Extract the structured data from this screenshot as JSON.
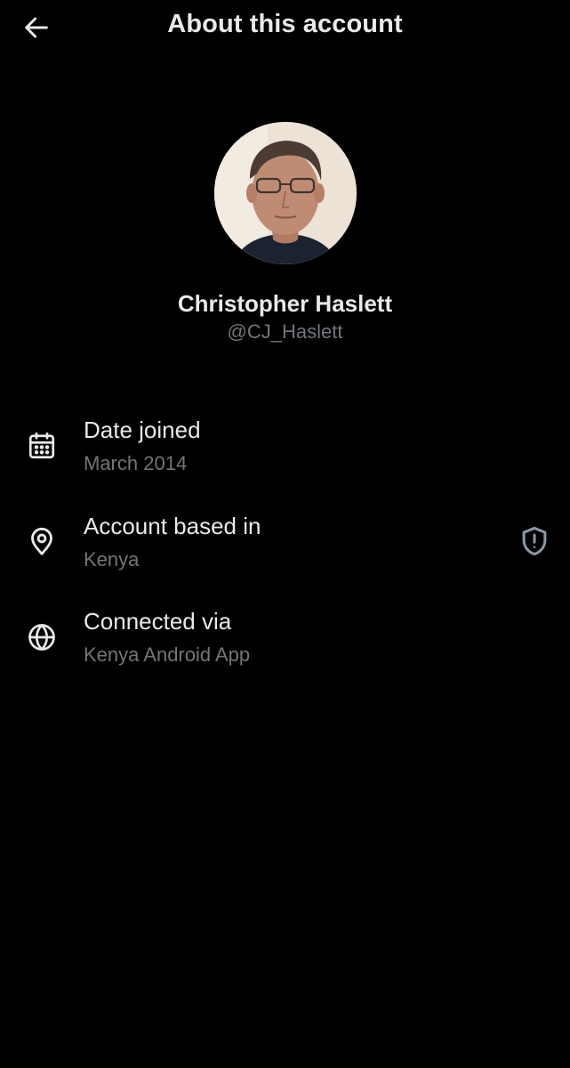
{
  "header": {
    "back_icon": "arrow-left-icon",
    "title": "About this account"
  },
  "profile": {
    "avatar_description": "profile-photo",
    "name": "Christopher Haslett",
    "handle": "@CJ_Haslett"
  },
  "info": [
    {
      "icon": "calendar-icon",
      "label": "Date joined",
      "value": "March 2014"
    },
    {
      "icon": "location-pin-icon",
      "label": "Account based in",
      "value": "Kenya",
      "trailing_icon": "shield-alert-icon"
    },
    {
      "icon": "globe-icon",
      "label": "Connected via",
      "value": "Kenya Android App"
    }
  ],
  "colors": {
    "background": "#000000",
    "primary_text": "#e7e9ea",
    "secondary_text": "#71767b",
    "shield_icon": "#8b98a5"
  }
}
